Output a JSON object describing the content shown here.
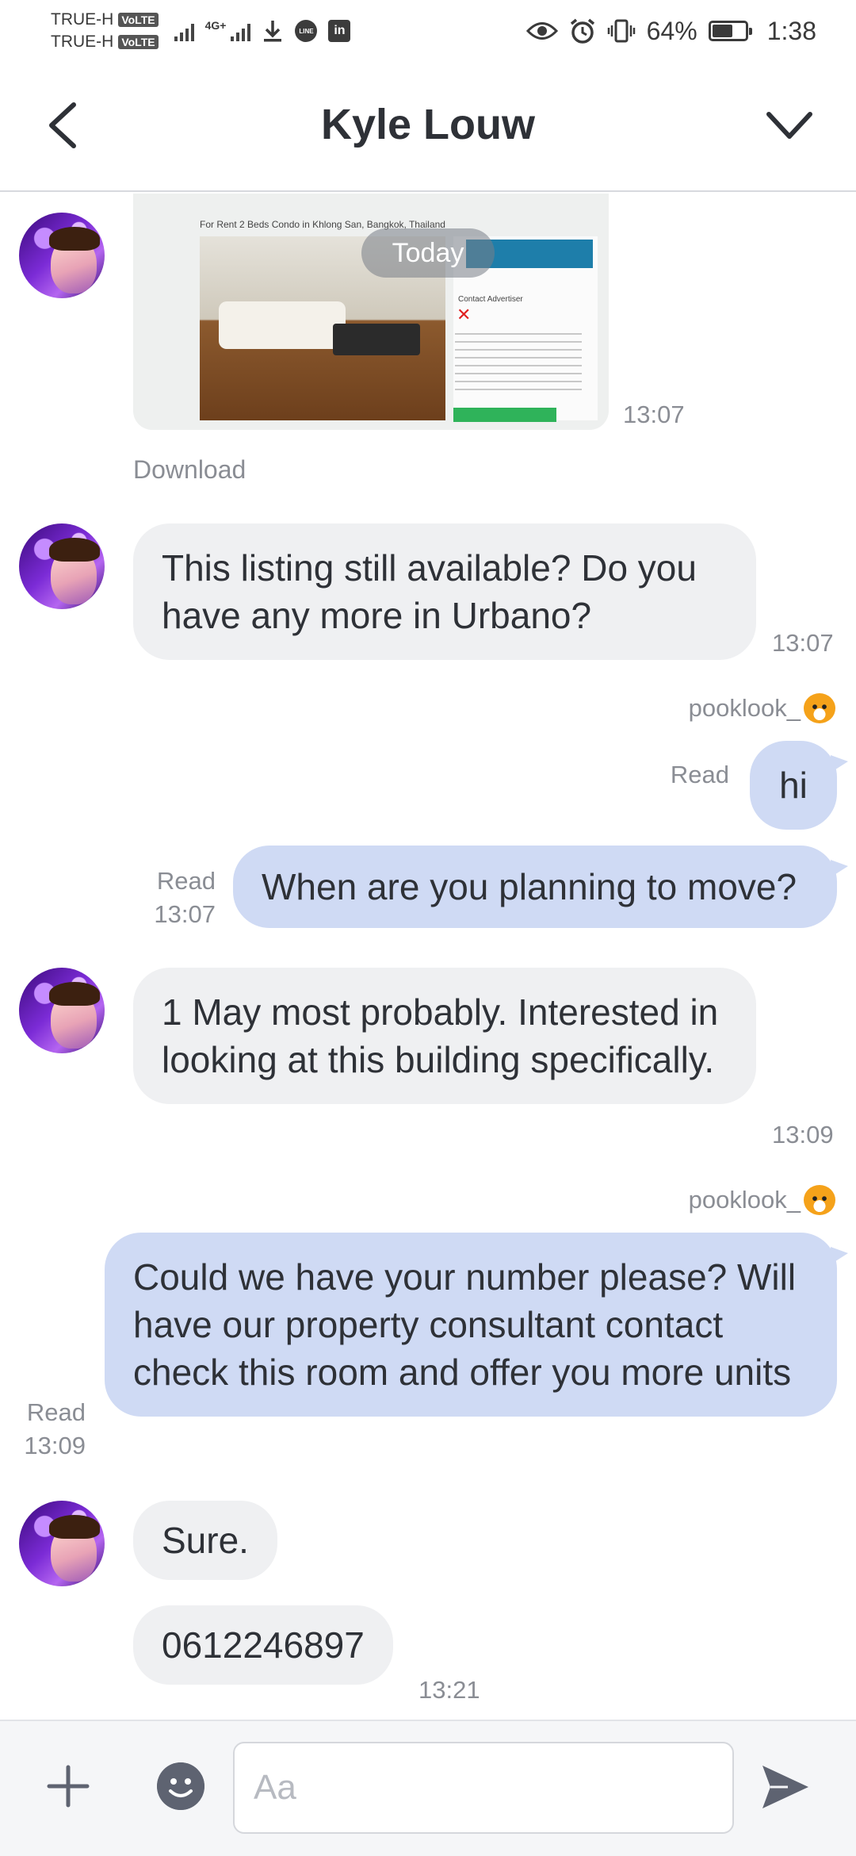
{
  "status_bar": {
    "carrier_1": "TRUE-H",
    "carrier_2": "TRUE-H",
    "volte_1": "VoLTE",
    "volte_2": "VoLTE",
    "network": "4G+",
    "battery": "64%",
    "battery_level": 0.64,
    "time": "1:38"
  },
  "header": {
    "title": "Kyle Louw"
  },
  "messages": {
    "date_divider": "Today",
    "m1_time": "13:07",
    "m1_download": "Download",
    "m2_text": "This listing still available? Do you have any more in Urbano?",
    "m2_time": "13:07",
    "m3_sender": "pooklook_",
    "m3_read": "Read",
    "m3_text": "hi",
    "m4_read": "Read",
    "m4_time": "13:07",
    "m4_text": "When are you planning to move?",
    "m5_text": "1 May most probably. Interested in looking at this building specifically.",
    "m5_time": "13:09",
    "m6_sender": "pooklook_",
    "m6_read": "Read",
    "m6_time": "13:09",
    "m6_text": "Could we have your number please? Will have our property consultant contact check this room and offer you more units",
    "m7_text": "Sure.",
    "m8_text": "0612246897",
    "m8_time": "13:21"
  },
  "attachment": {
    "listing_heading": "For Rent 2 Beds Condo in Khlong San, Bangkok, Thailand",
    "contact": "Contact Advertiser"
  },
  "composer": {
    "placeholder": "Aa"
  }
}
